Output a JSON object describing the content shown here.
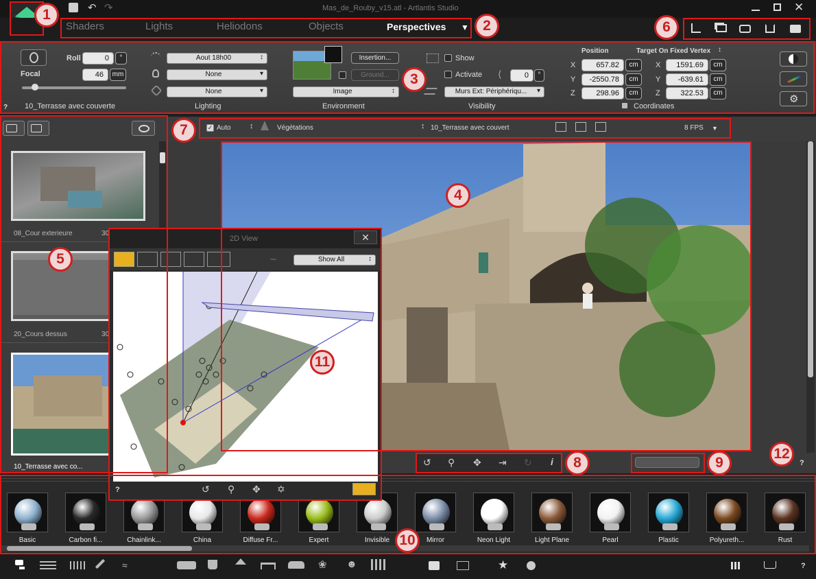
{
  "window": {
    "title": "Mas_de_Rouby_v15.atl - Artlantis Studio"
  },
  "tabs": [
    {
      "label": "Shaders"
    },
    {
      "label": "Lights"
    },
    {
      "label": "Heliodons"
    },
    {
      "label": "Objects"
    },
    {
      "label": "Perspectives",
      "active": true
    }
  ],
  "badges": [
    "1",
    "2",
    "3",
    "4",
    "5",
    "6",
    "7",
    "8",
    "9",
    "10",
    "11",
    "12"
  ],
  "inspector": {
    "camera": {
      "roll_label": "Roll",
      "roll_value": "0",
      "roll_unit": "°",
      "focal_label": "Focal",
      "focal_value": "46",
      "focal_unit": "mm",
      "view_name": "10_Terrasse avec couverte",
      "help": "?"
    },
    "lighting": {
      "title": "Lighting",
      "heliodon": "Aout 18h00",
      "light_group": "None",
      "light_group2": "None"
    },
    "environment": {
      "title": "Environment",
      "insertion_label": "Insertion...",
      "ground_label": "Ground...",
      "background_type": "Image"
    },
    "visibility": {
      "title": "Visibility",
      "show_label": "Show",
      "activate_label": "Activate",
      "clip_value": "0",
      "clip_unit": "°",
      "layer": "Murs Ext: Périphériqu..."
    },
    "coordinates": {
      "title": "Coordinates",
      "position_label": "Position",
      "target_label": "Target On Fixed Vertex",
      "position": [
        {
          "axis": "X",
          "value": "657.82",
          "unit": "cm"
        },
        {
          "axis": "Y",
          "value": "-2550.78",
          "unit": "cm"
        },
        {
          "axis": "Z",
          "value": "298.96",
          "unit": "cm"
        }
      ],
      "target": [
        {
          "axis": "X",
          "value": "1591.69",
          "unit": "cm"
        },
        {
          "axis": "Y",
          "value": "-639.61",
          "unit": "cm"
        },
        {
          "axis": "Z",
          "value": "322.53",
          "unit": "cm"
        }
      ]
    }
  },
  "viewbar": {
    "auto_label": "Auto",
    "layer_label": "Végétations",
    "view_label": "10_Terrasse avec couvert",
    "fps": "8 FPS"
  },
  "list": {
    "items": [
      {
        "name": "08_Cour exterieure",
        "num": "30"
      },
      {
        "name": "20_Cours dessus",
        "num": "30"
      },
      {
        "name": "10_Terrasse avec co..."
      }
    ]
  },
  "view2d": {
    "title": "2D View",
    "filter": "Show All",
    "help": "?"
  },
  "help12": "?",
  "shaders": [
    {
      "label": "Basic",
      "color": "#8fb2cf"
    },
    {
      "label": "Carbon fi...",
      "color": "#2a2a2a"
    },
    {
      "label": "Chainlink...",
      "color": "#9a9a9a"
    },
    {
      "label": "China",
      "color": "#e8e8e8"
    },
    {
      "label": "Diffuse Fr...",
      "color": "#c92a1e"
    },
    {
      "label": "Expert",
      "color": "#9abd1c"
    },
    {
      "label": "Invisible",
      "color": "#cccccc"
    },
    {
      "label": "Mirror",
      "color": "#7c8ea8"
    },
    {
      "label": "Neon Light",
      "color": "#ffffff"
    },
    {
      "label": "Light Plane",
      "color": "#8a5a3a"
    },
    {
      "label": "Pearl",
      "color": "#f2f2f2"
    },
    {
      "label": "Plastic",
      "color": "#29a9d6"
    },
    {
      "label": "Polyureth...",
      "color": "#7a4a22"
    },
    {
      "label": "Rust",
      "color": "#5a3422"
    }
  ],
  "bottom": {
    "help": "?"
  }
}
